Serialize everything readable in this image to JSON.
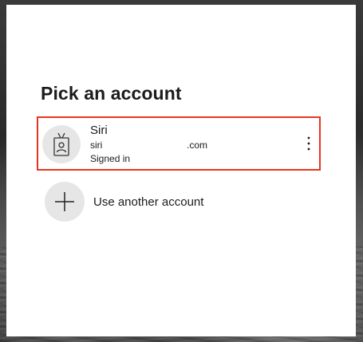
{
  "dialog": {
    "title": "Pick an account"
  },
  "accounts": [
    {
      "name": "Siri",
      "email_user": "siri",
      "email_domain": ".com",
      "status": "Signed in",
      "avatar_icon": "badge-id-icon",
      "more_icon": "more-vertical-icon"
    }
  ],
  "other_account": {
    "label": "Use another account",
    "icon": "plus-icon"
  },
  "colors": {
    "selection_outline": "#e8361e",
    "dialog_bg": "#ffffff",
    "avatar_bg": "#e6e6e6",
    "text": "#1b1b1b"
  }
}
